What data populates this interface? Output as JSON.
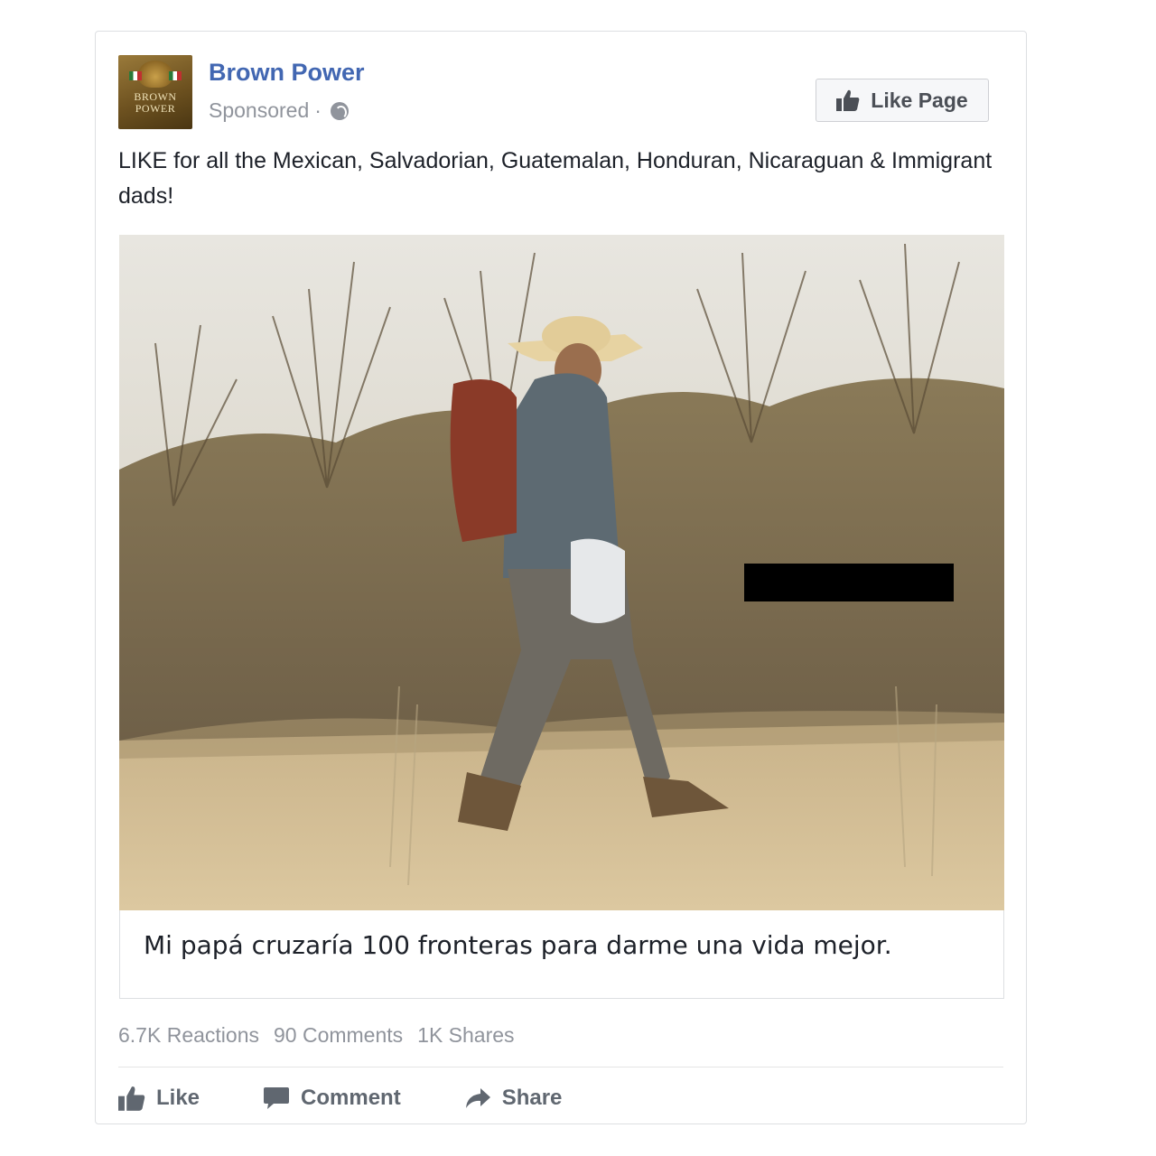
{
  "post": {
    "page_name": "Brown Power",
    "sponsored_label": "Sponsored",
    "separator": "·",
    "privacy_icon": "globe-icon",
    "avatar_logo_text": "BROWN POWER",
    "like_page_label": "Like Page",
    "text": "LIKE for all the Mexican, Salvadorian, Guatemalan, Honduran, Nicaraguan & Immigrant dads!",
    "image_caption": "Mi papá cruzaría 100 fronteras para darme una vida mejor.",
    "stats": {
      "reactions": "6.7K Reactions",
      "comments": "90 Comments",
      "shares": "1K Shares"
    },
    "actions": {
      "like": "Like",
      "comment": "Comment",
      "share": "Share"
    }
  },
  "colors": {
    "brand_blue": "#4267b2",
    "meta_gray": "#90949c",
    "action_gray": "#606770",
    "text": "#1d2129"
  }
}
